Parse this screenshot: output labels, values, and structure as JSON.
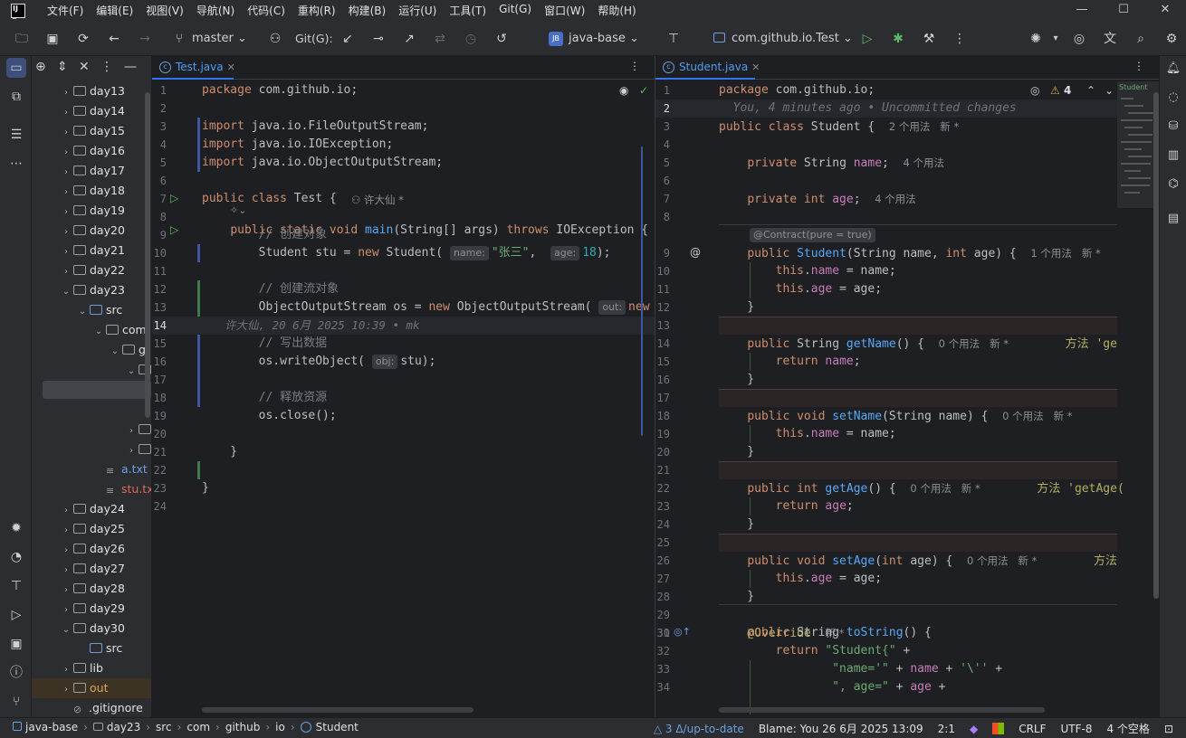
{
  "menubar": {
    "items": [
      "文件(F)",
      "编辑(E)",
      "视图(V)",
      "导航(N)",
      "代码(C)",
      "重构(R)",
      "构建(B)",
      "运行(U)",
      "工具(T)",
      "Git(G)",
      "窗口(W)",
      "帮助(H)"
    ],
    "window_controls": [
      "—",
      "☐",
      "✕"
    ]
  },
  "toolbar": {
    "branch": "master",
    "git_label": "Git(G):",
    "project_badge": "JB",
    "project": "java-base",
    "run_config": "com.github.io.Test"
  },
  "project_tree": [
    {
      "label": "day13",
      "indent": 0,
      "chev": "›"
    },
    {
      "label": "day14",
      "indent": 0,
      "chev": "›"
    },
    {
      "label": "day15",
      "indent": 0,
      "chev": "›"
    },
    {
      "label": "day16",
      "indent": 0,
      "chev": "›"
    },
    {
      "label": "day17",
      "indent": 0,
      "chev": "›"
    },
    {
      "label": "day18",
      "indent": 0,
      "chev": "›"
    },
    {
      "label": "day19",
      "indent": 0,
      "chev": "›"
    },
    {
      "label": "day20",
      "indent": 0,
      "chev": "›"
    },
    {
      "label": "day21",
      "indent": 0,
      "chev": "›"
    },
    {
      "label": "day22",
      "indent": 0,
      "chev": "›"
    },
    {
      "label": "day23",
      "indent": 0,
      "chev": "⌄"
    },
    {
      "label": "src",
      "indent": 1,
      "chev": "⌄",
      "blue": true
    },
    {
      "label": "com",
      "indent": 2,
      "chev": "⌄"
    },
    {
      "label": "g",
      "indent": 3,
      "chev": "⌄"
    },
    {
      "label": "[",
      "indent": 4,
      "chev": "⌄"
    },
    {
      "label": "",
      "indent": 4,
      "chev": ""
    },
    {
      "label": "",
      "indent": 4,
      "chev": ""
    },
    {
      "label": "[",
      "indent": 4,
      "chev": "›"
    },
    {
      "label": "[",
      "indent": 4,
      "chev": "›"
    },
    {
      "label": "a.txt",
      "indent": 2,
      "chev": "",
      "file": true,
      "color": "#6ea0de"
    },
    {
      "label": "stu.txt",
      "indent": 2,
      "chev": "",
      "file": true,
      "color": "#e06c5b"
    },
    {
      "label": "day24",
      "indent": 0,
      "chev": "›"
    },
    {
      "label": "day25",
      "indent": 0,
      "chev": "›"
    },
    {
      "label": "day26",
      "indent": 0,
      "chev": "›"
    },
    {
      "label": "day27",
      "indent": 0,
      "chev": "›"
    },
    {
      "label": "day28",
      "indent": 0,
      "chev": "›"
    },
    {
      "label": "day29",
      "indent": 0,
      "chev": "›"
    },
    {
      "label": "day30",
      "indent": 0,
      "chev": "⌄"
    },
    {
      "label": "src",
      "indent": 1,
      "chev": "",
      "blue": true
    },
    {
      "label": "lib",
      "indent": 0,
      "chev": "›"
    },
    {
      "label": "out",
      "indent": 0,
      "chev": "›",
      "color": "#e0a35b"
    },
    {
      "label": ".gitignore",
      "indent": 0,
      "chev": "",
      "file": true
    }
  ],
  "left_editor": {
    "tab": "Test.java",
    "author_hint": "许大仙 *",
    "blame_line": "许大仙, 20 6月 2025 10:39 • mk",
    "lines": [
      {
        "n": "1",
        "html": "<span class='kw'>package</span> com.github.io;"
      },
      {
        "n": "2",
        "html": ""
      },
      {
        "n": "3",
        "html": "<span class='kw'>import</span> java.io.FileOutputStream;"
      },
      {
        "n": "4",
        "html": "<span class='kw'>import</span> java.io.IOException;"
      },
      {
        "n": "5",
        "html": "<span class='kw'>import</span> java.io.ObjectOutputStream;"
      },
      {
        "n": "6",
        "html": ""
      },
      {
        "n": "7",
        "html": "<span class='kw'>public class</span> Test {"
      },
      {
        "n": "8",
        "html": "    <span class='kw'>public static void</span> <span class='fn'>main</span>(String[] args) <span class='kw'>throws</span> IOException {"
      },
      {
        "n": "9",
        "html": "        <span class='cmt'>// 创建对象</span>"
      },
      {
        "n": "10",
        "html": "        Student stu = <span class='kw'>new</span> Student( <span class='hint'>name:</span><span class='str'>\"张三\"</span>,  <span class='hint'>age:</span><span class='num'>18</span>);"
      },
      {
        "n": "11",
        "html": ""
      },
      {
        "n": "12",
        "html": "        <span class='cmt'>// 创建流对象</span>"
      },
      {
        "n": "13",
        "html": "        ObjectOutputStream os = <span class='kw'>new</span> ObjectOutputStream( <span class='hint'>out:</span><span class='kw'>new</span>"
      },
      {
        "n": "14",
        "html": ""
      },
      {
        "n": "15",
        "html": "        <span class='cmt'>// 写出数据</span>"
      },
      {
        "n": "16",
        "html": "        os.writeObject( <span class='hint'>obj:</span>stu);"
      },
      {
        "n": "17",
        "html": ""
      },
      {
        "n": "18",
        "html": "        <span class='cmt'>// 释放资源</span>"
      },
      {
        "n": "19",
        "html": "        os.close();"
      },
      {
        "n": "20",
        "html": ""
      },
      {
        "n": "21",
        "html": "    }"
      },
      {
        "n": "22",
        "html": ""
      },
      {
        "n": "23",
        "html": "}"
      },
      {
        "n": "24",
        "html": ""
      }
    ]
  },
  "right_editor": {
    "tab": "Student.java",
    "warnings": "4",
    "contract": "@Contract(pure = true)",
    "lines": [
      {
        "n": "1",
        "html": "<span class='kw'>package</span> com.github.io;"
      },
      {
        "n": "2",
        "html": "  <span class='blame'>You, 4 minutes ago • Uncommitted changes</span>"
      },
      {
        "n": "3",
        "html": "<span class='kw'>public class</span> Student {  <span class='usage'>2 个用法   新 *</span>"
      },
      {
        "n": "4",
        "html": ""
      },
      {
        "n": "5",
        "html": "    <span class='kw'>private</span> String <span class='fld'>name</span>;  <span class='usage'>4 个用法</span>"
      },
      {
        "n": "6",
        "html": ""
      },
      {
        "n": "7",
        "html": "    <span class='kw'>private int</span> <span class='fld'>age</span>;  <span class='usage'>4 个用法</span>"
      },
      {
        "n": "8",
        "html": ""
      },
      {
        "n": "9",
        "html": "    <span class='kw'>public</span> <span class='fn'>Student</span>(String name, <span class='kw'>int</span> age) {  <span class='usage'>1 个用法   新 *</span>"
      },
      {
        "n": "10",
        "html": "        <span class='kw'>this</span>.<span class='fld'>name</span> = name;"
      },
      {
        "n": "11",
        "html": "        <span class='kw'>this</span>.<span class='fld'>age</span> = age;"
      },
      {
        "n": "12",
        "html": "    }"
      },
      {
        "n": "13",
        "html": ""
      },
      {
        "n": "14",
        "html": "    <span class='kw'>public</span> String <span class='fn'>getName</span>() {  <span class='usage'>0 个用法   新 *</span>        <span class='ann'>方法 'ge</span>"
      },
      {
        "n": "15",
        "html": "        <span class='kw'>return</span> <span class='fld'>name</span>;"
      },
      {
        "n": "16",
        "html": "    }"
      },
      {
        "n": "17",
        "html": ""
      },
      {
        "n": "18",
        "html": "    <span class='kw'>public void</span> <span class='fn'>setName</span>(String name) {  <span class='usage'>0 个用法   新 *</span>"
      },
      {
        "n": "19",
        "html": "        <span class='kw'>this</span>.<span class='fld'>name</span> = name;"
      },
      {
        "n": "20",
        "html": "    }"
      },
      {
        "n": "21",
        "html": ""
      },
      {
        "n": "22",
        "html": "    <span class='kw'>public int</span> <span class='fn'>getAge</span>() {  <span class='usage'>0 个用法   新 *</span>        <span class='ann'>方法 'getAge(</span>"
      },
      {
        "n": "23",
        "html": "        <span class='kw'>return</span> <span class='fld'>age</span>;"
      },
      {
        "n": "24",
        "html": "    }"
      },
      {
        "n": "25",
        "html": ""
      },
      {
        "n": "26",
        "html": "    <span class='kw'>public void</span> <span class='fn'>setAge</span>(<span class='kw'>int</span> age) {  <span class='usage'>0 个用法   新 *</span>        <span class='ann'>方法</span>"
      },
      {
        "n": "27",
        "html": "        <span class='kw'>this</span>.<span class='fld'>age</span> = age;"
      },
      {
        "n": "28",
        "html": "    }"
      },
      {
        "n": "29",
        "html": ""
      },
      {
        "n": "30",
        "html": "    <span class='ann'>@Override</span>  <span class='usage'>新 *</span>"
      },
      {
        "n": "31",
        "html": "    <span class='kw'>public</span> String <span class='fn'>toString</span>() {"
      },
      {
        "n": "32",
        "html": "        <span class='kw'>return</span> <span class='str'>\"Student{\"</span> +"
      },
      {
        "n": "33",
        "html": "                <span class='str'>\"name='\"</span> + <span class='fld'>name</span> + <span class='str'>'\\''</span> +"
      },
      {
        "n": "34",
        "html": "                <span class='str'>\", age=\"</span> + <span class='fld'>age</span> +"
      }
    ]
  },
  "statusbar": {
    "crumbs": [
      "java-base",
      "day23",
      "src",
      "com",
      "github",
      "io",
      "Student"
    ],
    "vcs": "3 Δ/up-to-date",
    "blame": "Blame: You 26 6月 2025 13:09",
    "position": "2:1",
    "line_sep": "CRLF",
    "encoding": "UTF-8",
    "indent": "4 个空格"
  }
}
